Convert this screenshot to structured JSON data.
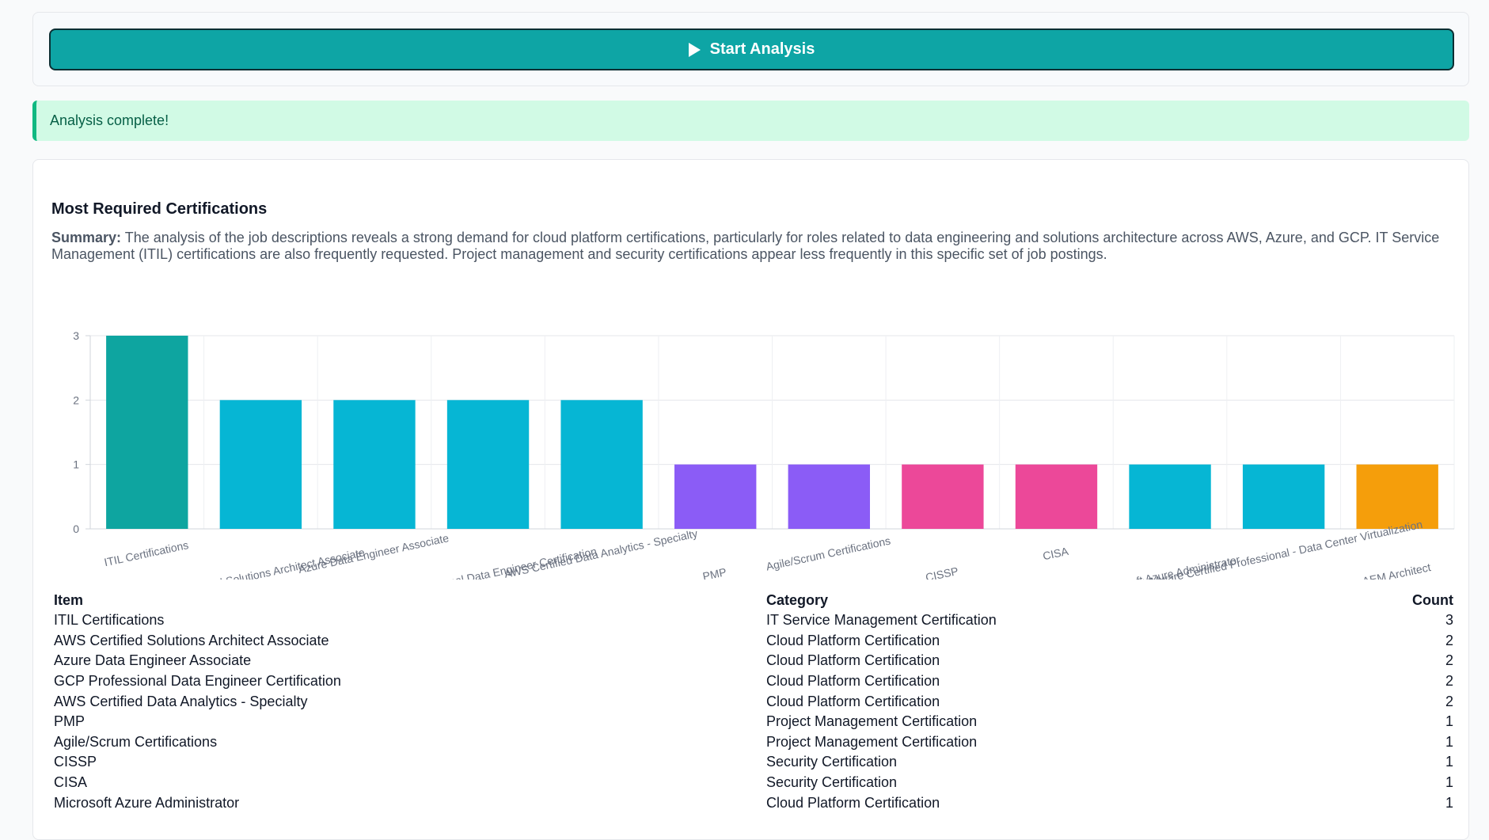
{
  "actions": {
    "start_label": "Start Analysis",
    "start_icon": "play-icon"
  },
  "status": {
    "message": "Analysis complete!"
  },
  "results": {
    "title": "Most Required Certifications",
    "summary_label": "Summary:",
    "summary_text": "The analysis of the job descriptions reveals a strong demand for cloud platform certifications, particularly for roles related to data engineering and solutions architecture across AWS, Azure, and GCP. IT Service Management (ITIL) certifications are also frequently requested. Project management and security certifications appear less frequently in this specific set of job postings."
  },
  "chart_data": {
    "type": "bar",
    "categories": [
      "ITIL Certifications",
      "AWS Certified Solutions Architect Associate",
      "Azure Data Engineer Associate",
      "GCP Professional Data Engineer Certification",
      "AWS Certified Data Analytics - Specialty",
      "PMP",
      "Agile/Scrum Certifications",
      "CISSP",
      "CISA",
      "Microsoft Azure Administrator",
      "VMware Certified Professional - Data Center Virtualization",
      "AEM Architect"
    ],
    "values": [
      3,
      2,
      2,
      2,
      2,
      1,
      1,
      1,
      1,
      1,
      1,
      1
    ],
    "colors": [
      "#0ea5a0",
      "#06b6d4",
      "#06b6d4",
      "#06b6d4",
      "#06b6d4",
      "#8b5cf6",
      "#8b5cf6",
      "#ec4899",
      "#ec4899",
      "#06b6d4",
      "#06b6d4",
      "#f59e0b"
    ],
    "yticks": [
      0,
      1,
      2,
      3
    ],
    "ylim": [
      0,
      3
    ],
    "grid": true,
    "xlabel": "",
    "ylabel": ""
  },
  "table": {
    "headers": {
      "item": "Item",
      "category": "Category",
      "count": "Count"
    },
    "rows": [
      {
        "item": "ITIL Certifications",
        "category": "IT Service Management Certification",
        "count": "3"
      },
      {
        "item": "AWS Certified Solutions Architect Associate",
        "category": "Cloud Platform Certification",
        "count": "2"
      },
      {
        "item": "Azure Data Engineer Associate",
        "category": "Cloud Platform Certification",
        "count": "2"
      },
      {
        "item": "GCP Professional Data Engineer Certification",
        "category": "Cloud Platform Certification",
        "count": "2"
      },
      {
        "item": "AWS Certified Data Analytics - Specialty",
        "category": "Cloud Platform Certification",
        "count": "2"
      },
      {
        "item": "PMP",
        "category": "Project Management Certification",
        "count": "1"
      },
      {
        "item": "Agile/Scrum Certifications",
        "category": "Project Management Certification",
        "count": "1"
      },
      {
        "item": "CISSP",
        "category": "Security Certification",
        "count": "1"
      },
      {
        "item": "CISA",
        "category": "Security Certification",
        "count": "1"
      },
      {
        "item": "Microsoft Azure Administrator",
        "category": "Cloud Platform Certification",
        "count": "1"
      }
    ]
  }
}
